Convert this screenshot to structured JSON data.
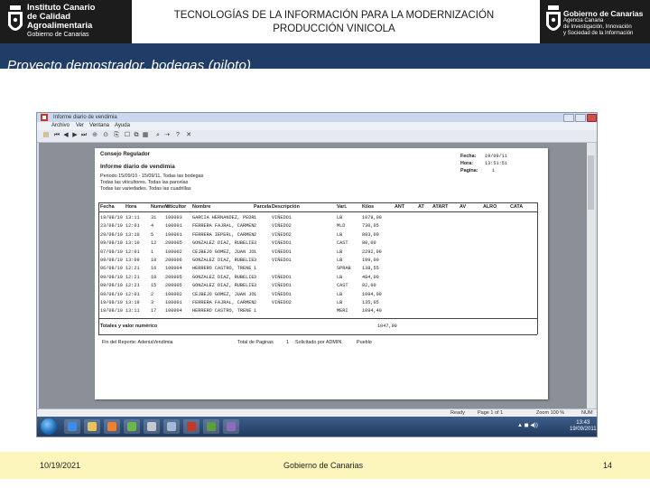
{
  "header": {
    "left_logo": {
      "line1": "Instituto Canario",
      "line2": "de Calidad",
      "line3": "Agroalimentaria",
      "line4": "Gobierno de Canarias"
    },
    "title_line1": "TECNOLOGÍAS DE LA INFORMACIÓN PARA LA MODERNIZACIÓN",
    "title_line2": "PRODUCCIÓN VINICOLA",
    "right_logo": {
      "line1": "Gobierno de Canarias",
      "line2": "Agencia Canaria",
      "line3": "de Investigación, Innovación",
      "line4": "y Sociedad de la Información"
    }
  },
  "band": {
    "title": "Proyecto demostrador, bodegas (piloto)"
  },
  "app_window": {
    "title": "Informe diario de vendimia",
    "menu": [
      "Archivo",
      "Ver",
      "Ventana",
      "Ayuda"
    ],
    "report": {
      "org": "Consejo Regulador",
      "title": "Informe diario de vendimia",
      "filters": [
        "Periodo 15/09/10 - 15/09/11. Todas las bodegas",
        "Todas las viticultores. Todas las parcelas",
        "Todas las variedades. Todas las cuadrillas"
      ],
      "meta_labels": [
        "Fecha:",
        "Hora:",
        "Pagina:"
      ],
      "meta_values": [
        "19/09/11",
        "13:51:51",
        "1"
      ],
      "columns": [
        "Fecha",
        "Hora",
        "Numero",
        "Viticultor",
        "Nombre",
        "Parcela",
        "Descripción",
        "Vari.",
        "Kilos",
        "ANT",
        "AT",
        "ATART",
        "AV",
        "ALRO",
        "CATA"
      ],
      "rows": [
        [
          "19/08/10",
          "13:11",
          "31",
          "100003",
          "GARCIA HERNANDEZ, PEDR",
          "1",
          "VIÑEDO1",
          "LB",
          "1079,00"
        ],
        [
          "23/08/10",
          "12:01",
          "4",
          "100001",
          "FERRERA FAJRAL, CARMEN",
          "2",
          "VIÑEDO2",
          "MLD",
          "730,05"
        ],
        [
          "29/08/10",
          "13:10",
          "5",
          "100001",
          "FERRERA IEPERL, CARMEN",
          "2",
          "VIÑEDO2",
          "LB",
          "893,00"
        ],
        [
          "09/08/10",
          "13:10",
          "12",
          "200005",
          "GONZALEZ DIAZ, RUBELIE",
          "3",
          "VIÑEDO1",
          "CAST",
          "80,00"
        ],
        [
          "07/08/10",
          "12:01",
          "1",
          "100002",
          "CEJBEJO GOMEZ, JUAN JO",
          "1",
          "VIÑEDO1",
          "LB",
          "2292,00"
        ],
        [
          "09/08/10",
          "13:09",
          "18",
          "200006",
          "GONZALEZ DIAZ, RUBELIE",
          "3",
          "VIÑEDO1",
          "LB",
          "199,00"
        ],
        [
          "06/08/10",
          "12:21",
          "16",
          "100004",
          "HERRERO CASTRO, TRENE",
          "1",
          "",
          "SPRAB",
          "138,55"
        ],
        [
          "09/08/10",
          "12:21",
          "18",
          "200005",
          "GONZALEZ DIAZ, RUBELIE",
          "3",
          "VIÑEDO1",
          "LB",
          "484,00"
        ],
        [
          "09/08/10",
          "12:21",
          "15",
          "200005",
          "GONZALEZ DIAZ, RUBELIE",
          "3",
          "VIÑEDO1",
          "CAST",
          "82,00"
        ],
        [
          "09/08/10",
          "12:01",
          "2",
          "100002",
          "CEJBEJO GOMEZ, JUAN JO",
          "1",
          "VIÑEDO1",
          "LB",
          "1094,00"
        ],
        [
          "19/08/10",
          "13:19",
          "3",
          "100001",
          "FERRERA FAJRAL, CARMEN",
          "2",
          "VIÑEDO2",
          "LB",
          "135,05"
        ],
        [
          "19/08/10",
          "13:11",
          "17",
          "100004",
          "HERRERO CASTRO, TRENE",
          "1",
          "",
          "MERI",
          "1094,40"
        ]
      ],
      "totals_label": "Totales y valor numérico",
      "totals_value": "1047,90",
      "footer_items": [
        "Fin del Reporte: AdeniaVendimia",
        "Total de Paginas",
        "1",
        "Solicitado por ADMIN",
        "Pueblo"
      ]
    },
    "status": {
      "ready": "Ready",
      "page": "Page 1 of 1",
      "zoom": "Zoom 100 %",
      "num": "NUM"
    },
    "clock": {
      "time": "13:43",
      "date": "19/09/2011"
    }
  },
  "footer": {
    "date": "10/19/2021",
    "center": "Gobierno de Canarias",
    "page": "14"
  },
  "colors": {
    "band": "#1f3d66",
    "footer": "#fcf6bd",
    "logo_bg": "#1c1c1c"
  }
}
